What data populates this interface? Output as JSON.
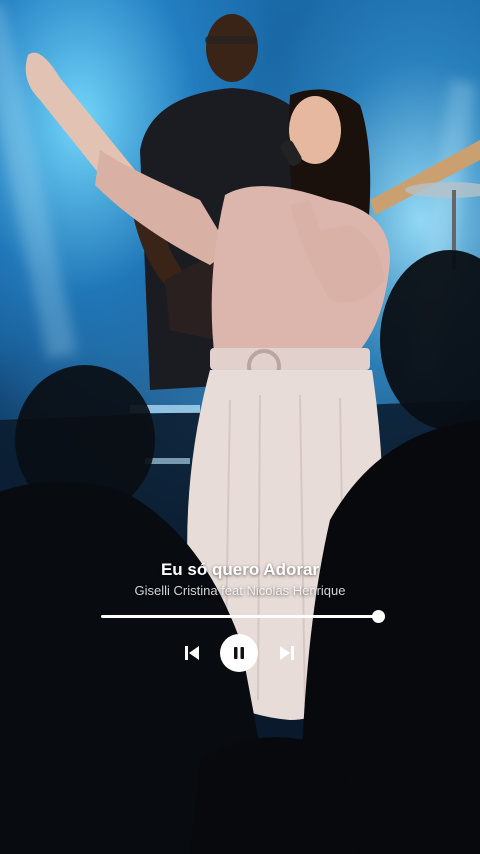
{
  "player": {
    "title": "Eu só quero Adorar",
    "artist": "Giselli Cristina feat Nicolas Henrique",
    "progress": 1.0,
    "state": "playing",
    "icons": {
      "previous": "skip-previous-icon",
      "play_pause": "pause-icon",
      "next": "skip-next-icon"
    }
  },
  "colors": {
    "stage_light": "#5cc8f0",
    "controls": "#ffffff",
    "dress": "#e8dcd8"
  }
}
